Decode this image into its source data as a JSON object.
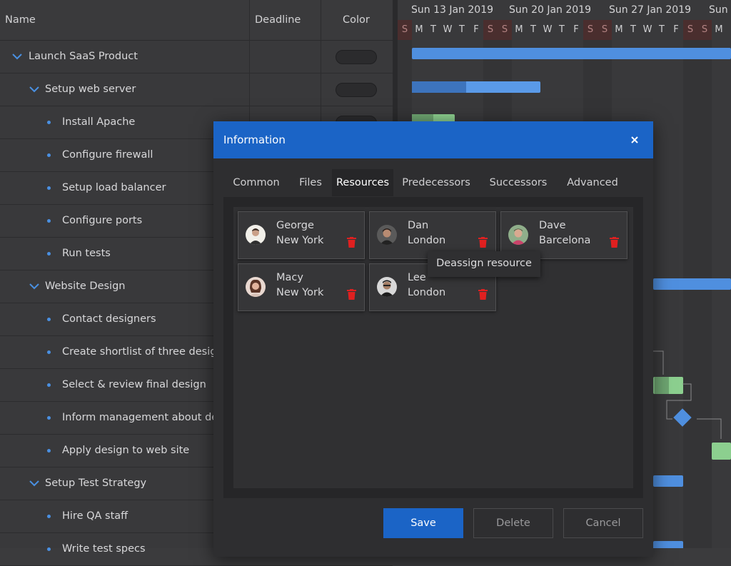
{
  "grid": {
    "headers": {
      "name": "Name",
      "deadline": "Deadline",
      "color": "Color"
    },
    "rows": [
      {
        "label": "Launch SaaS Product",
        "level": 0,
        "kind": "parent",
        "pill": true
      },
      {
        "label": "Setup web server",
        "level": 1,
        "kind": "parent",
        "pill": true
      },
      {
        "label": "Install Apache",
        "level": 2,
        "kind": "leaf",
        "pill": true
      },
      {
        "label": "Configure firewall",
        "level": 2,
        "kind": "leaf",
        "pill": false
      },
      {
        "label": "Setup load balancer",
        "level": 2,
        "kind": "leaf",
        "pill": false
      },
      {
        "label": "Configure ports",
        "level": 2,
        "kind": "leaf",
        "pill": false
      },
      {
        "label": "Run tests",
        "level": 2,
        "kind": "leaf",
        "pill": false
      },
      {
        "label": "Website Design",
        "level": 1,
        "kind": "parent",
        "pill": false
      },
      {
        "label": "Contact designers",
        "level": 2,
        "kind": "leaf",
        "pill": false
      },
      {
        "label": "Create shortlist of three designers",
        "level": 2,
        "kind": "leaf",
        "pill": false
      },
      {
        "label": "Select & review final design",
        "level": 2,
        "kind": "leaf",
        "pill": false
      },
      {
        "label": "Inform management about decision",
        "level": 2,
        "kind": "leaf",
        "pill": false
      },
      {
        "label": "Apply design to web site",
        "level": 2,
        "kind": "leaf",
        "pill": false
      },
      {
        "label": "Setup Test Strategy",
        "level": 1,
        "kind": "parent",
        "pill": false
      },
      {
        "label": "Hire QA staff",
        "level": 2,
        "kind": "leaf",
        "pill": false
      },
      {
        "label": "Write test specs",
        "level": 2,
        "kind": "leaf",
        "pill": false
      }
    ]
  },
  "timeline": {
    "weeks": [
      "Sun 13 Jan 2019",
      "Sun 20 Jan 2019",
      "Sun 27 Jan 2019",
      "Sun"
    ],
    "days": [
      "S",
      "M",
      "T",
      "W",
      "T",
      "F",
      "S",
      "S",
      "M",
      "T",
      "W",
      "T",
      "F",
      "S",
      "S",
      "M",
      "T",
      "W",
      "T",
      "F",
      "S",
      "S",
      "M"
    ]
  },
  "dialog": {
    "title": "Information",
    "tabs": [
      "Common",
      "Files",
      "Resources",
      "Predecessors",
      "Successors",
      "Advanced"
    ],
    "active_tab": "Resources",
    "resources": [
      {
        "name": "George",
        "city": "New York"
      },
      {
        "name": "Dan",
        "city": "London"
      },
      {
        "name": "Dave",
        "city": "Barcelona"
      },
      {
        "name": "Macy",
        "city": "New York"
      },
      {
        "name": "Lee",
        "city": "London"
      }
    ],
    "tooltip": "Deassign resource",
    "buttons": {
      "save": "Save",
      "delete": "Delete",
      "cancel": "Cancel"
    }
  },
  "colors": {
    "accent": "#1b64c6",
    "bar_blue": "#4f8fdf",
    "bar_green": "#8ccf8f",
    "trash_red": "#e02020",
    "weekend": "#4a2e2e"
  }
}
